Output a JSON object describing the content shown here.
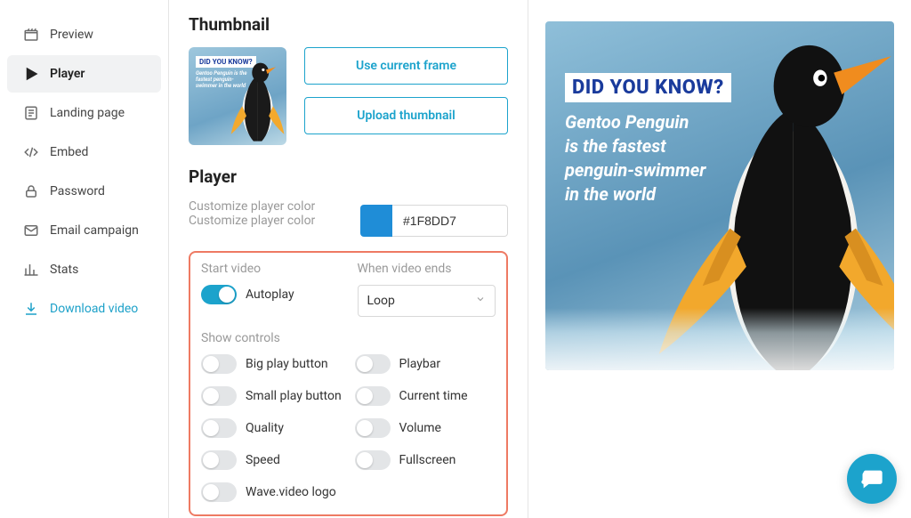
{
  "sidebar": {
    "items": [
      {
        "key": "preview",
        "label": "Preview"
      },
      {
        "key": "player",
        "label": "Player"
      },
      {
        "key": "landing",
        "label": "Landing page"
      },
      {
        "key": "embed",
        "label": "Embed"
      },
      {
        "key": "password",
        "label": "Password"
      },
      {
        "key": "email",
        "label": "Email campaign"
      },
      {
        "key": "stats",
        "label": "Stats"
      },
      {
        "key": "download",
        "label": "Download video"
      }
    ],
    "active_key": "player"
  },
  "thumbnail": {
    "heading": "Thumbnail",
    "use_frame_label": "Use current frame",
    "upload_label": "Upload thumbnail",
    "overlay_title": "DID YOU KNOW?",
    "overlay_sub": "Gentoo Penguin is the fastest penguin-swimmer in the world"
  },
  "player": {
    "heading": "Player",
    "color_label": "Customize player color",
    "color_value": "#1F8DD7",
    "start_label": "Start video",
    "autoplay_label": "Autoplay",
    "autoplay_on": true,
    "ends_label": "When video ends",
    "ends_value": "Loop",
    "controls_label": "Show controls",
    "controls_left": [
      {
        "key": "big_play",
        "label": "Big play button",
        "on": false
      },
      {
        "key": "small_play",
        "label": "Small play button",
        "on": false
      },
      {
        "key": "quality",
        "label": "Quality",
        "on": false
      },
      {
        "key": "speed",
        "label": "Speed",
        "on": false
      },
      {
        "key": "logo",
        "label": "Wave.video logo",
        "on": false
      }
    ],
    "controls_right": [
      {
        "key": "playbar",
        "label": "Playbar",
        "on": false
      },
      {
        "key": "current_time",
        "label": "Current time",
        "on": false
      },
      {
        "key": "volume",
        "label": "Volume",
        "on": false
      },
      {
        "key": "fullscreen",
        "label": "Fullscreen",
        "on": false
      }
    ]
  },
  "preview": {
    "overlay_title": "DID YOU KNOW?",
    "overlay_sub": "Gentoo Penguin\nis the fastest\npenguin-swimmer\nin the world"
  }
}
